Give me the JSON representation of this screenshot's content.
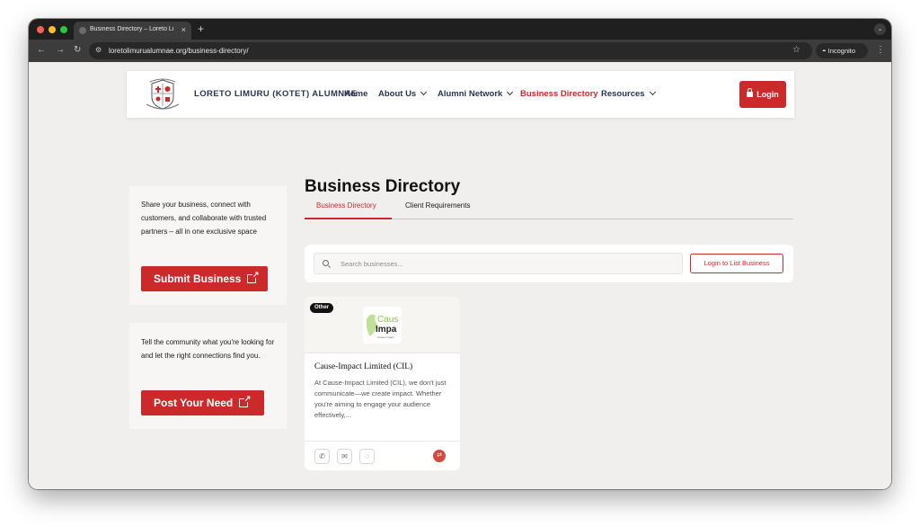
{
  "browser": {
    "tab_title": "Business Directory – Loreto Li",
    "tab_close": "×",
    "new_tab": "+",
    "url": "loretolimurualumnae.org/business-directory/",
    "incognito_label": "Incognito"
  },
  "header": {
    "brand": "LORETO LIMURU (KOTET) ALUMNAE",
    "nav": {
      "home": "Home",
      "about": "About Us",
      "alumni": "Alumni Network",
      "directory": "Business Directory",
      "resources": "Resources"
    },
    "login": "Login"
  },
  "page": {
    "title": "Business Directory",
    "tabs": [
      "Business Directory",
      "Client Requirements"
    ]
  },
  "sidebar": {
    "submit_text": "Share your business, connect with customers, and collaborate with trusted partners – all in one exclusive space",
    "submit_button": "Submit Business",
    "need_text": "Tell the community what you're looking for and let the right connections find you.",
    "need_button": "Post Your Need"
  },
  "search": {
    "placeholder": "Search businesses...",
    "list_button": "Login to List Business"
  },
  "listing": {
    "badge": "Other",
    "logo_text_1": "Caus",
    "logo_text_2": "Impa",
    "logo_tagline": "Cause Impact",
    "name": "Cause-Impact Limited (CIL)",
    "description": "At Cause-Impact Limited (CIL), we don't just communicate—we create impact. Whether you're aiming to engage your audience effectively,..."
  },
  "colors": {
    "accent": "#cc2a2a",
    "nav_text": "#2e3350",
    "page_bg": "#f0efed"
  }
}
